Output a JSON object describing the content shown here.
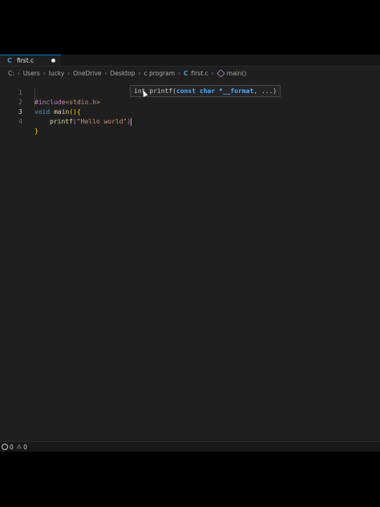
{
  "tab": {
    "icon": "C",
    "filename": "first.c",
    "modified": true
  },
  "breadcrumb": {
    "segments": [
      "C:",
      "Users",
      "lucky",
      "OneDrive",
      "Desktop",
      "c program"
    ],
    "file_icon": "C",
    "file": "first.c",
    "symbol": "main()"
  },
  "editor": {
    "lines": [
      {
        "number": "1",
        "directive": "#include",
        "path": "<stdio.h>"
      },
      {
        "number": "2",
        "kw": "void",
        "fn": "main",
        "open": "(){"
      },
      {
        "number": "3",
        "fn": "printf",
        "open_paren": "(",
        "str": "\"Hello world\"",
        "close_paren": ")"
      },
      {
        "number": "4",
        "close": "}"
      }
    ]
  },
  "param_hint": {
    "prefix": "int printf(",
    "param": "const char *__format",
    "suffix": ", ...)"
  },
  "status": {
    "errors": "0",
    "warnings": "0"
  },
  "colors": {
    "accent": "#0078d4",
    "c_icon": "#519aba"
  }
}
